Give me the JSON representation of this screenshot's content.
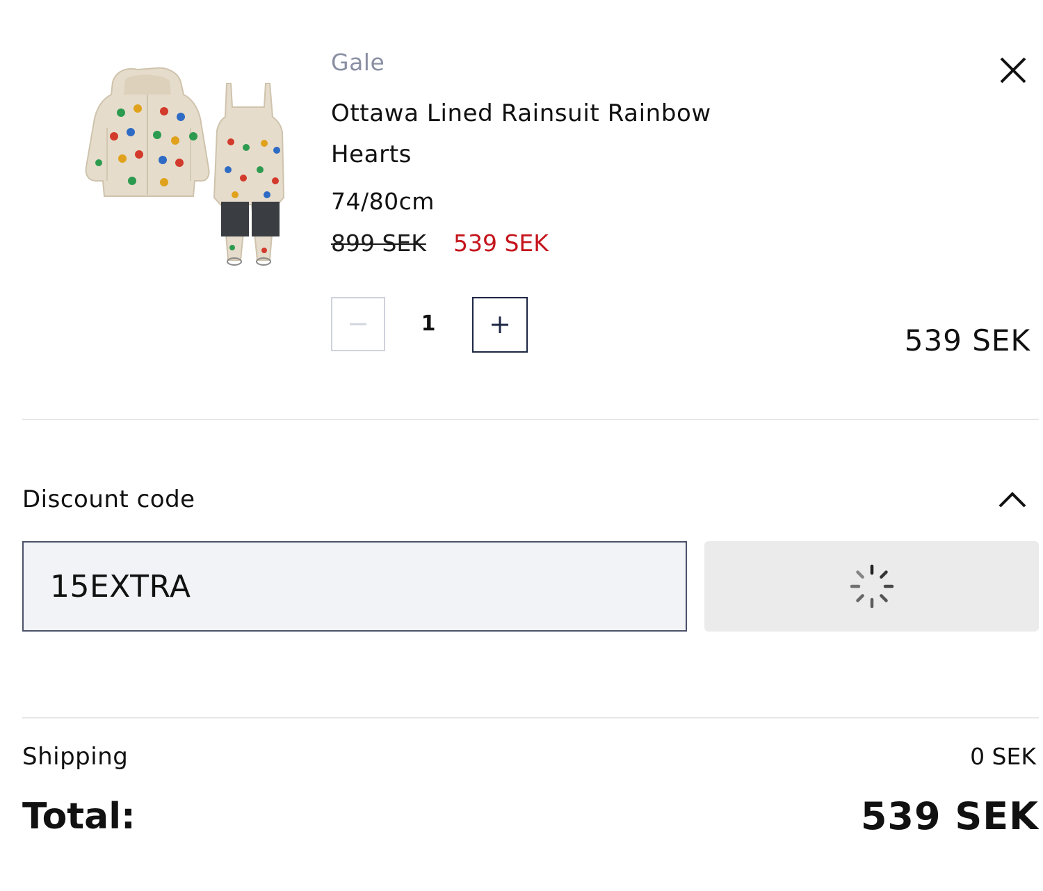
{
  "cart_item": {
    "image_alt": "Ottawa Lined Rainsuit Rainbow Hearts",
    "brand": "Gale",
    "name": "Ottawa Lined Rainsuit Rainbow Hearts",
    "size": "74/80cm",
    "original_price": "899 SEK",
    "sale_price": "539 SEK",
    "quantity": "1",
    "line_total": "539 SEK",
    "remove_icon": "close-icon",
    "minus_icon": "minus-icon",
    "plus_icon": "plus-icon"
  },
  "discount": {
    "label": "Discount code",
    "toggle_icon": "chevron-up-icon",
    "code_value": "15EXTRA",
    "apply_state_icon": "loading-spinner-icon"
  },
  "summary": {
    "shipping_label": "Shipping",
    "shipping_value": "0 SEK",
    "total_label": "Total:",
    "total_value": "539 SEK"
  },
  "colors": {
    "brand_text": "#8a8fa3",
    "sale_price": "#c4141b",
    "input_background": "#f2f3f6",
    "apply_button_background": "#ebebeb"
  }
}
